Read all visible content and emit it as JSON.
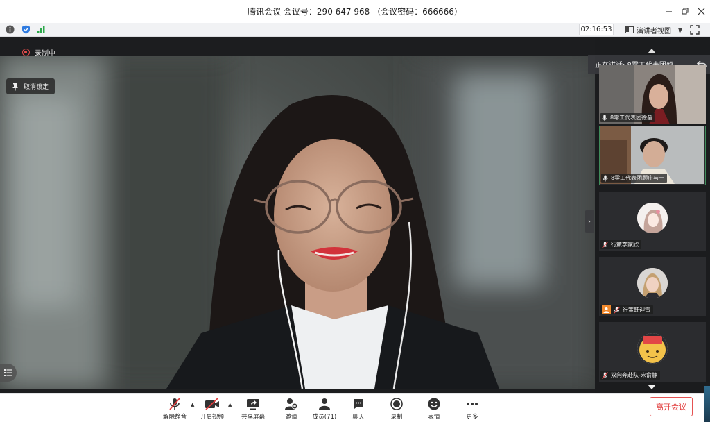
{
  "window": {
    "title": "腾讯会议 会议号：290 647 968 （会议密码：666666）"
  },
  "infobar": {
    "timer": "02:16:53",
    "view_label": "演讲者视图"
  },
  "stage": {
    "recording_label": "录制中",
    "unpin_label": "取消锁定",
    "speaking_label": "正在讲话: 8零工代表团颜..."
  },
  "participants": [
    {
      "name": "8零工代表团徐晶",
      "muted": false
    },
    {
      "name": "8零工代表团顾庄与一",
      "muted": false
    },
    {
      "name": "行策李家欣",
      "muted": true
    },
    {
      "name": "行策韩迎雪",
      "muted": true
    },
    {
      "name": "双向奔赴队-宋俞静",
      "muted": true
    }
  ],
  "toolbar": {
    "unmute": "解除静音",
    "start_video": "开启视频",
    "share_screen": "共享屏幕",
    "invite": "邀请",
    "members": "成员(71)",
    "chat": "聊天",
    "record": "录制",
    "reactions": "表情",
    "more": "更多",
    "leave": "离开会议"
  },
  "colors": {
    "accent_green": "#3f8c5a",
    "leave_red": "#e23c3c",
    "recording_red": "#e64c4c"
  }
}
